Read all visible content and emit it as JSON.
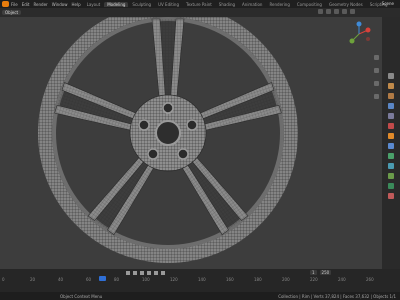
{
  "app": {
    "menus": [
      "File",
      "Edit",
      "Render",
      "Window",
      "Help"
    ],
    "tabs": [
      "Layout",
      "Modeling",
      "Sculpting",
      "UV Editing",
      "Texture Paint",
      "Shading",
      "Animation",
      "Rendering",
      "Compositing",
      "Geometry Nodes",
      "Scripting"
    ],
    "active_tab_index": 1,
    "scene_label": "Scene"
  },
  "viewport": {
    "mode_label": "Object",
    "model": "wheel-rim-wireframe",
    "colors": {
      "background": "#3d3d3d",
      "rim": "#8a8a8a",
      "wire": "#2a2a2a"
    }
  },
  "timeline": {
    "frames": [
      "1",
      "250"
    ],
    "ruler_ticks": [
      "0",
      "20",
      "40",
      "60",
      "80",
      "100",
      "120",
      "140",
      "160",
      "180",
      "200",
      "220",
      "240",
      "260"
    ],
    "current_frame_marker": "1"
  },
  "statusbar": {
    "left_text": "Object Context Menu",
    "right_text": "Collection | Rim | Verts 37,824 | Faces 37,632 | Objects 1/1"
  },
  "icons": {
    "gizmo": "navigation-gizmo",
    "play": "play-icon",
    "properties": [
      "tool-icon",
      "render-icon",
      "output-icon",
      "view-layer-icon",
      "scene-icon",
      "world-icon",
      "object-icon",
      "modifier-icon",
      "particles-icon",
      "physics-icon",
      "constraints-icon",
      "data-icon",
      "material-icon"
    ]
  }
}
